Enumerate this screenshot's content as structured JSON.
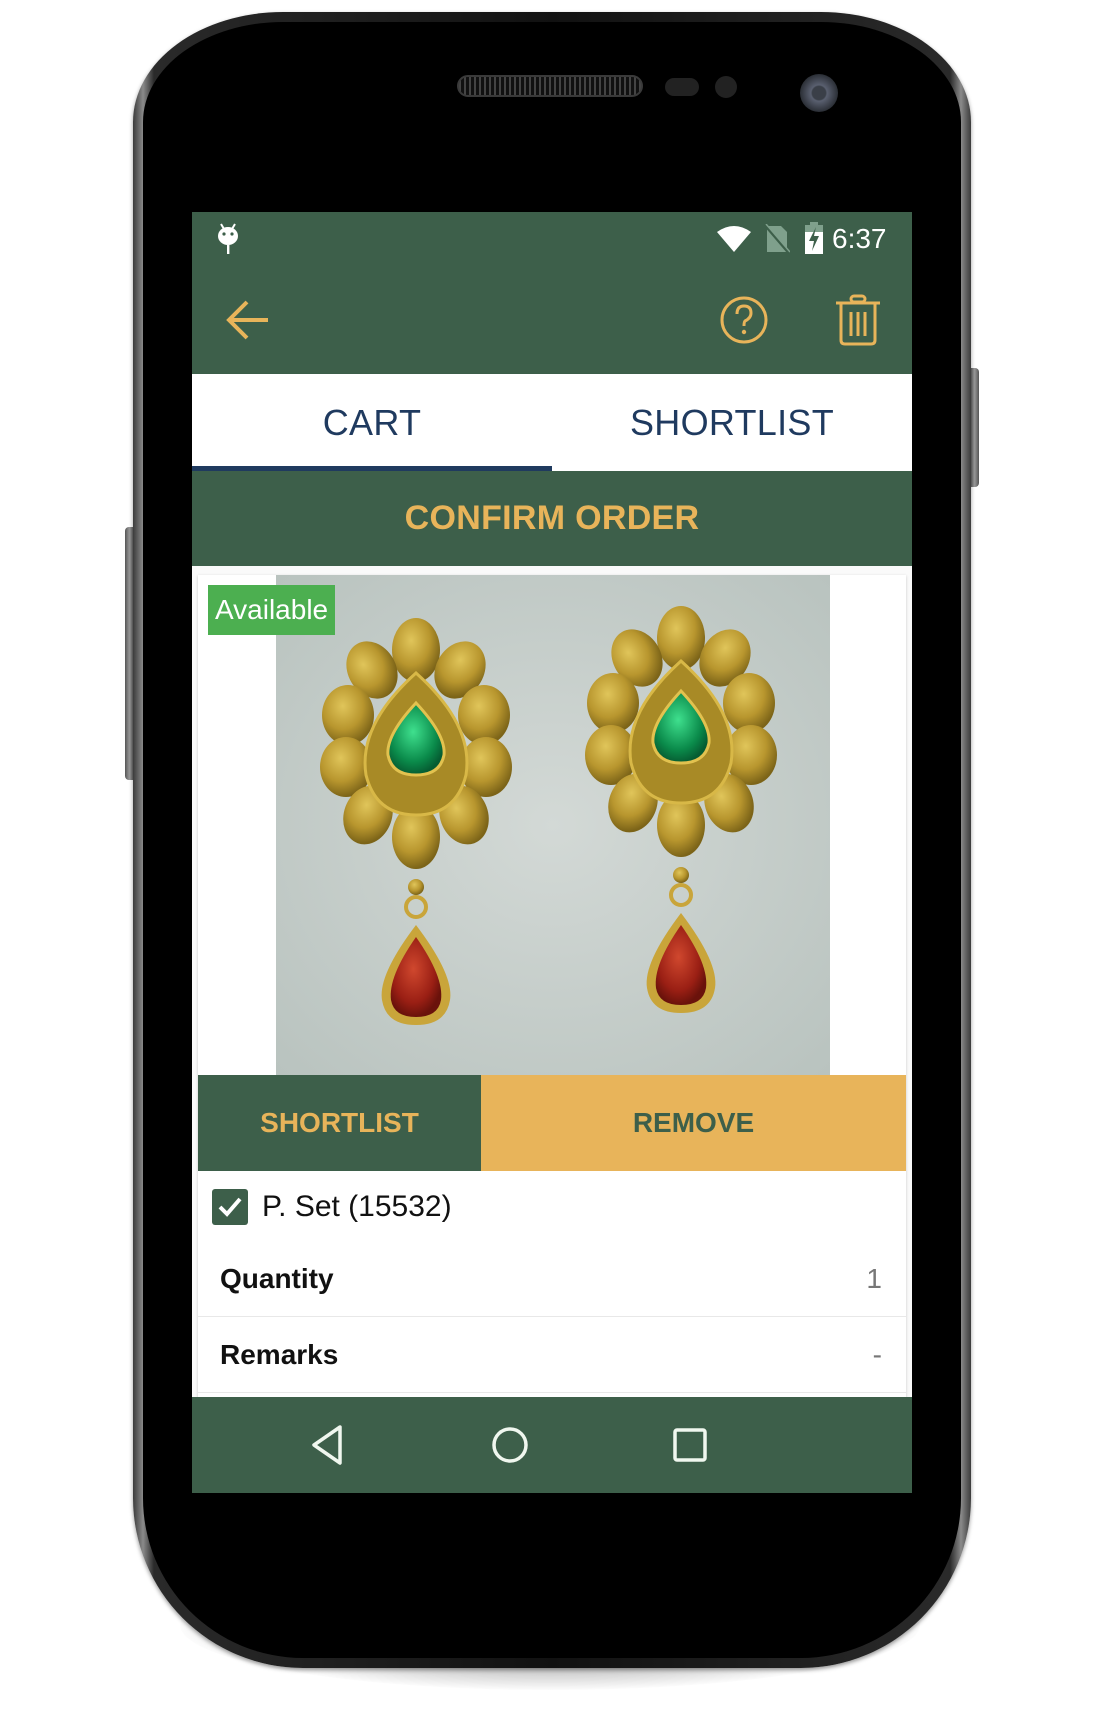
{
  "status_bar": {
    "time": "6:37",
    "icons": [
      "android-debug-icon",
      "wifi-icon",
      "no-sim-icon",
      "battery-charging-icon"
    ]
  },
  "toolbar": {
    "back_icon": "arrow-left-icon",
    "help_icon": "help-circle-icon",
    "delete_icon": "trash-icon"
  },
  "tabs": [
    {
      "label": "CART",
      "selected": true
    },
    {
      "label": "SHORTLIST",
      "selected": false
    }
  ],
  "confirm_order_label": "CONFIRM ORDER",
  "cart_item": {
    "availability_badge": "Available",
    "image_alt": "Gold earrings with green and red stones",
    "shortlist_label": "SHORTLIST",
    "remove_label": "REMOVE",
    "checked": true,
    "name": "P. Set (15532)",
    "details": [
      {
        "label": "Quantity",
        "value": "1"
      },
      {
        "label": "Remarks",
        "value": "-"
      }
    ]
  },
  "nav_bar": {
    "back_icon": "nav-back-icon",
    "home_icon": "nav-home-icon",
    "recents_icon": "nav-recents-icon"
  },
  "colors": {
    "primary_green": "#3D5F4A",
    "accent_gold": "#E8B45A",
    "tab_text_navy": "#1F3A5F",
    "available_green": "#4CAF50"
  }
}
